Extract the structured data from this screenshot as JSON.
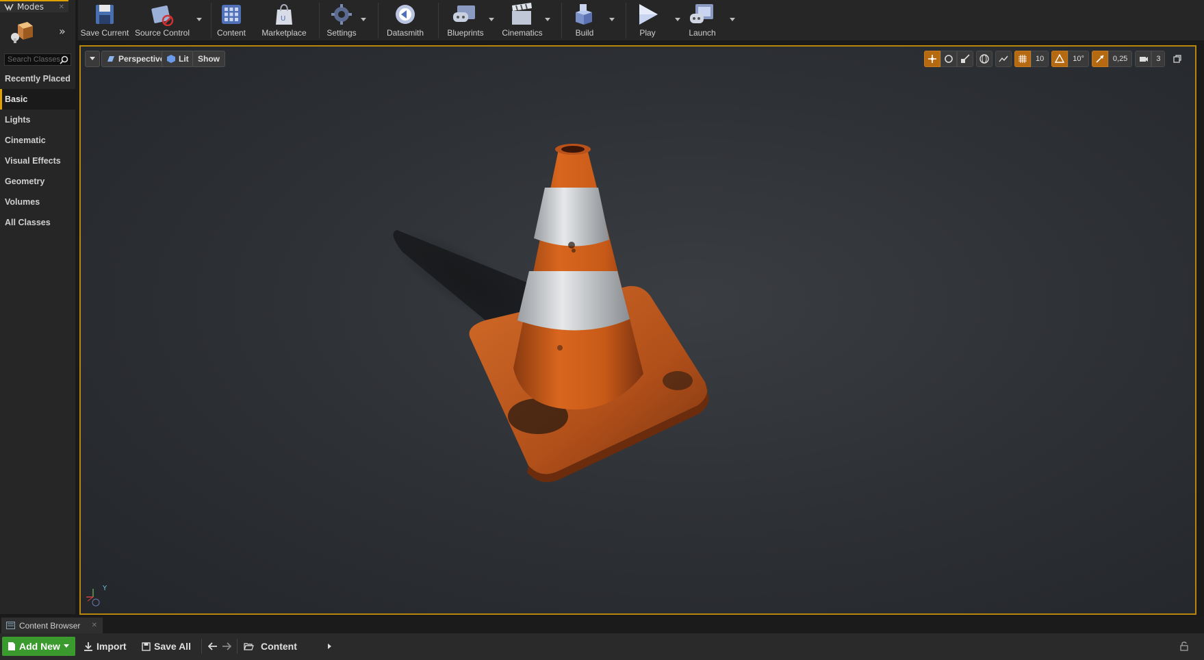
{
  "modes": {
    "tab_label": "Modes",
    "search_placeholder": "Search Classes",
    "categories": [
      "Recently Placed",
      "Basic",
      "Lights",
      "Cinematic",
      "Visual Effects",
      "Geometry",
      "Volumes",
      "All Classes"
    ],
    "active_category": "Basic"
  },
  "toolbar": {
    "save_current": "Save Current",
    "source_control": "Source Control",
    "content": "Content",
    "marketplace": "Marketplace",
    "settings": "Settings",
    "datasmith": "Datasmith",
    "blueprints": "Blueprints",
    "cinematics": "Cinematics",
    "build": "Build",
    "play": "Play",
    "launch": "Launch"
  },
  "viewport": {
    "perspective": "Perspective",
    "lit": "Lit",
    "show": "Show",
    "grid_snap": "10",
    "rotation_snap": "10°",
    "scale_snap": "0,25",
    "camera_speed": "3",
    "axis_y": "Y"
  },
  "content_browser": {
    "tab_label": "Content Browser",
    "add_new": "Add New",
    "import": "Import",
    "save_all": "Save All",
    "path_root": "Content"
  },
  "colors": {
    "accent": "#e0a000",
    "add_new_green": "#3a9a2e",
    "snap_orange": "#b56a12"
  }
}
